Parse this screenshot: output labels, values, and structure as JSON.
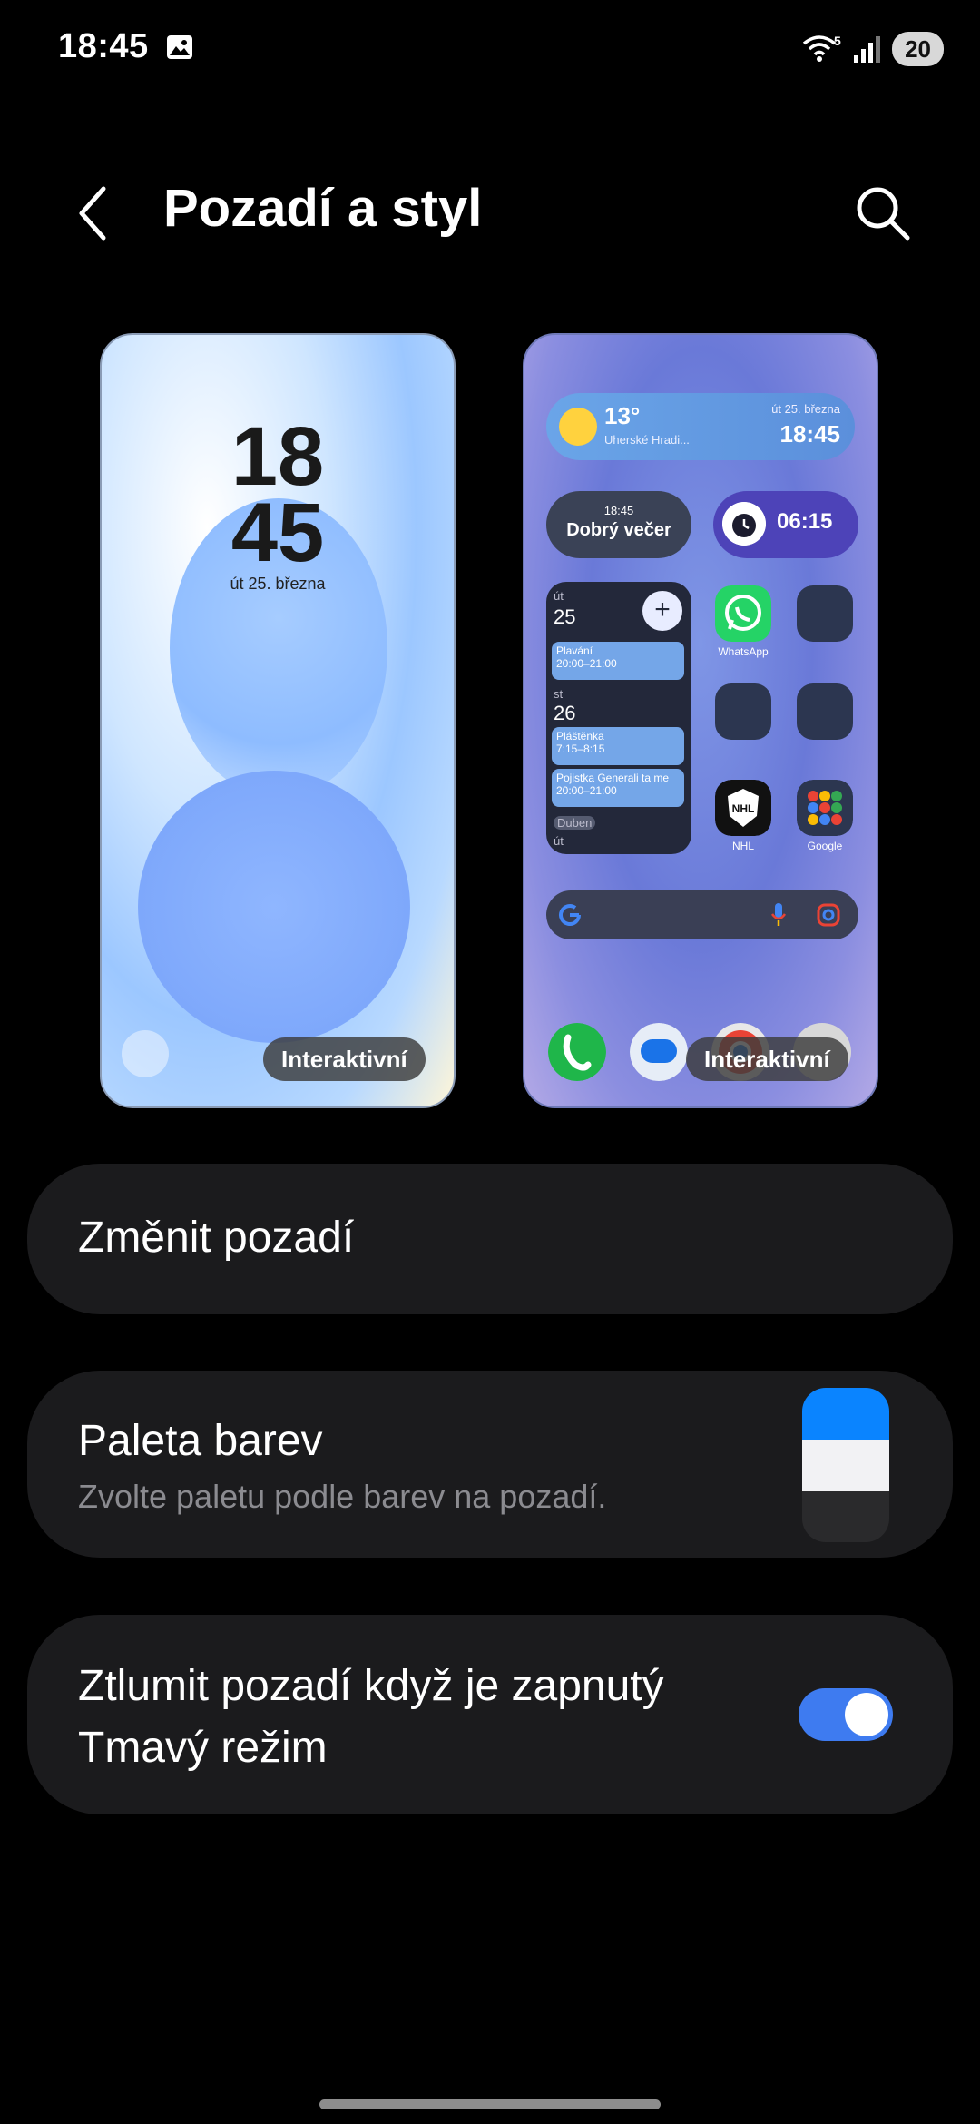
{
  "status_bar": {
    "time": "18:45",
    "battery": "20",
    "wifi_badge": "5"
  },
  "header": {
    "title": "Pozadí a styl"
  },
  "lock_preview": {
    "clock_hours": "18",
    "clock_minutes": "45",
    "date": "út 25. března",
    "label": "Interaktivní"
  },
  "home_preview": {
    "label": "Interaktivní",
    "weather": {
      "temp": "13°",
      "location": "Uherské Hradi...",
      "date": "út 25. března",
      "time": "18:45"
    },
    "greeting": {
      "time": "18:45",
      "text": "Dobrý večer"
    },
    "alarm": {
      "time": "06:15"
    },
    "calendar": {
      "day1_name": "út",
      "day1_num": "25",
      "event1_title": "Plavání",
      "event1_time": "20:00–21:00",
      "day2_name": "st",
      "day2_num": "26",
      "event2_title": "Pláštěnka",
      "event2_time": "7:15–8:15",
      "event3_title": "Pojistka Generali ta me",
      "event3_time": "20:00–21:00",
      "month_badge": "Duben",
      "day3_name": "út"
    },
    "apps": {
      "whatsapp": "WhatsApp",
      "nhl": "NHL",
      "google": "Google"
    }
  },
  "settings": {
    "change_wallpaper": "Změnit pozadí",
    "palette_title": "Paleta barev",
    "palette_subtitle": "Zvolte paletu podle barev na pozadí.",
    "palette_colors": [
      "#0a84ff",
      "#f2f2f4",
      "#2a2a2c"
    ],
    "dim_title_line1": "Ztlumit pozadí když je zapnutý",
    "dim_title_line2": "Tmavý režim",
    "dim_toggle_on": true
  }
}
